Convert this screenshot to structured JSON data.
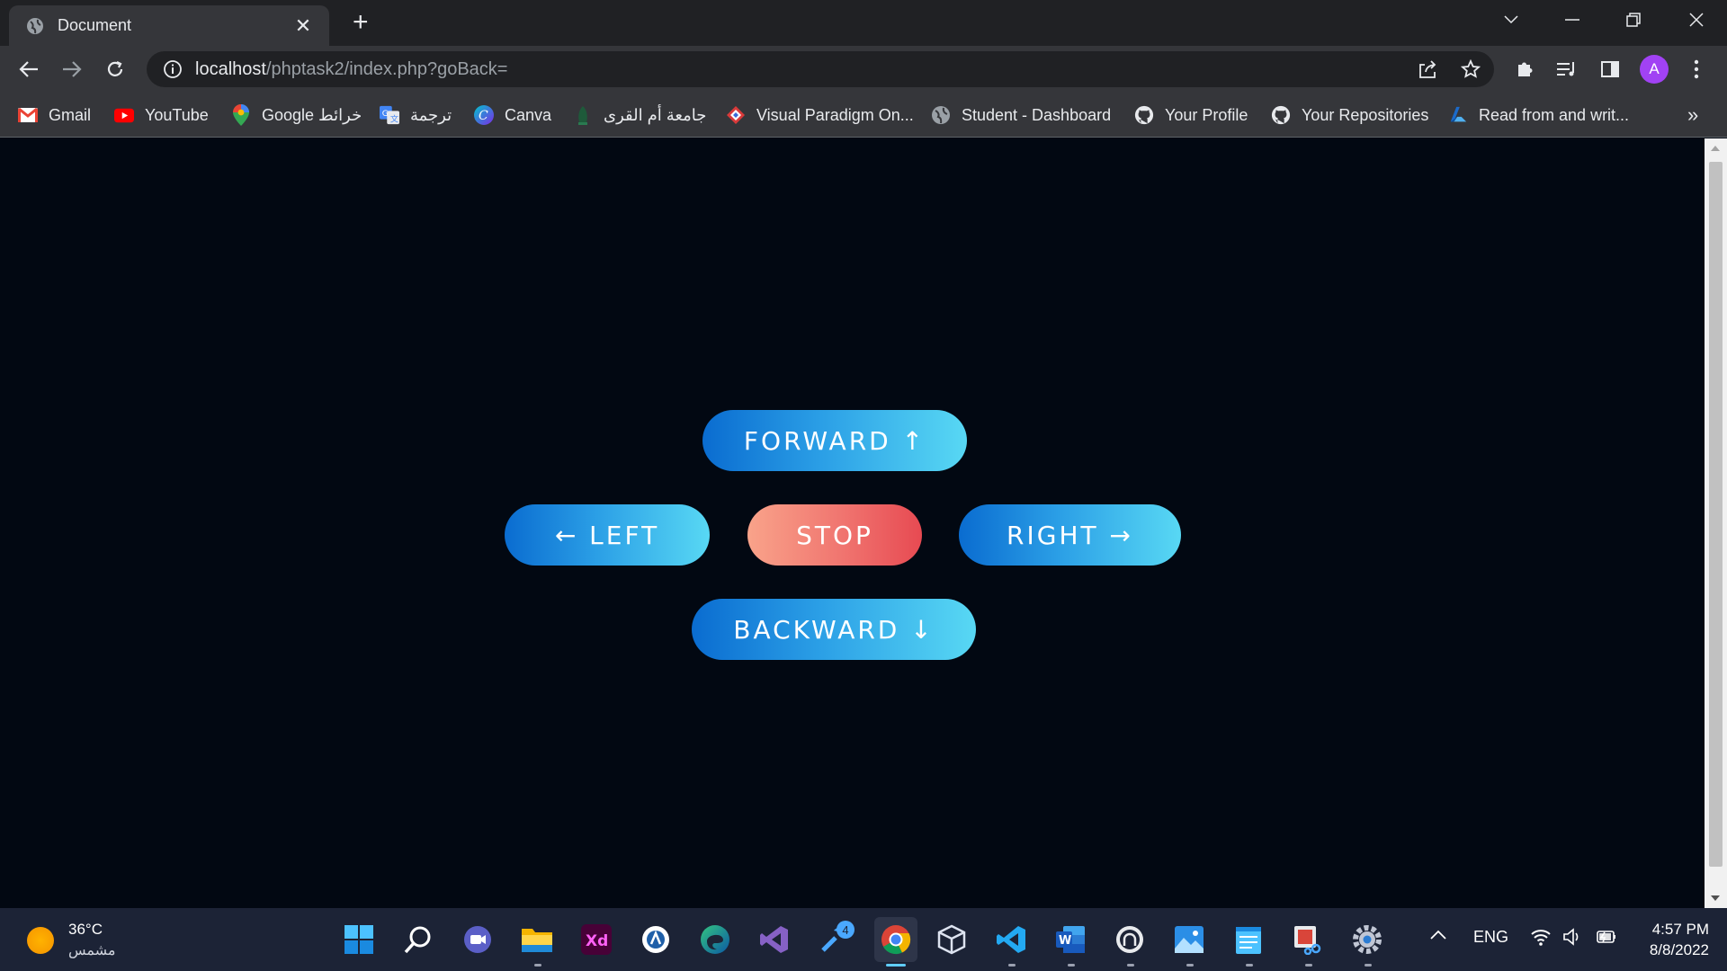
{
  "browser": {
    "tab_title": "Document",
    "tab_close": "✕",
    "new_tab": "+",
    "url_host": "localhost",
    "url_path": "/phptask2/index.php?goBack=",
    "avatar_letter": "A"
  },
  "bookmarks": [
    {
      "label": "Gmail",
      "icon": "gmail-icon"
    },
    {
      "label": "YouTube",
      "icon": "youtube-icon"
    },
    {
      "label": "Google خرائط",
      "icon": "google-maps-icon"
    },
    {
      "label": "ترجمة",
      "icon": "google-translate-icon"
    },
    {
      "label": "Canva",
      "icon": "canva-icon"
    },
    {
      "label": "جامعة أم القرى",
      "icon": "university-icon"
    },
    {
      "label": "Visual Paradigm On...",
      "icon": "visual-paradigm-icon"
    },
    {
      "label": "Student - Dashboard",
      "icon": "globe-icon"
    },
    {
      "label": "Your Profile",
      "icon": "github-icon"
    },
    {
      "label": "Your Repositories",
      "icon": "github-icon"
    },
    {
      "label": "Read from and writ...",
      "icon": "azure-icon"
    }
  ],
  "bookmarks_more": "»",
  "controls": {
    "forward": "FORWARD ↑",
    "left": "← LEFT",
    "stop": "STOP",
    "right": "RIGHT →",
    "backward": "BACKWARD ↓"
  },
  "colors": {
    "page_bg": "#020812",
    "button_blue_start": "#0a6cd0",
    "button_blue_end": "#58d8f4",
    "button_red_start": "#f9a38a",
    "button_red_end": "#e74a52"
  },
  "taskbar": {
    "weather_temp": "36°C",
    "weather_desc": "مشمس",
    "language": "ENG",
    "time": "4:57 PM",
    "date": "8/8/2022",
    "badge_count": "4",
    "apps": [
      "windows-start-icon",
      "search-icon",
      "teams-icon",
      "file-explorer-icon",
      "adobe-xd-icon",
      "app-icon",
      "edge-icon",
      "visual-studio-icon",
      "tools-icon",
      "chrome-icon",
      "virtualbox-icon",
      "vscode-icon",
      "word-icon",
      "github-desktop-icon",
      "photos-icon",
      "notepad-icon",
      "snipping-tool-icon",
      "settings-icon"
    ]
  }
}
